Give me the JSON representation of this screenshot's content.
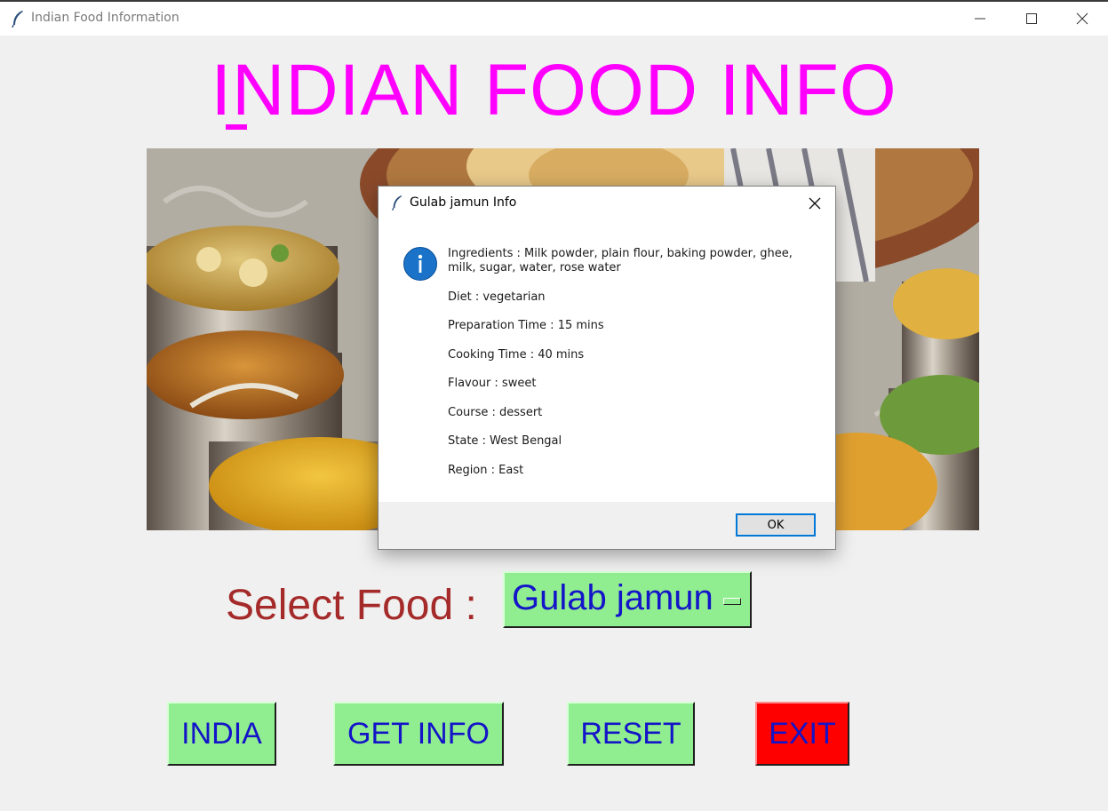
{
  "window": {
    "title": "Indian Food Information",
    "icon": "feather-icon"
  },
  "main": {
    "heading": "INDIAN FOOD INFO",
    "select_label": "Select Food :",
    "selected_food": "Gulab jamun",
    "buttons": {
      "india": "INDIA",
      "get_info": "GET INFO",
      "reset": "RESET",
      "exit": "EXIT"
    }
  },
  "dialog": {
    "title": "Gulab jamun Info",
    "icon": "info-icon",
    "lines": [
      "Ingredients  :  Milk powder, plain flour, baking powder, ghee, milk, sugar, water, rose water",
      "Diet  :  vegetarian",
      "Preparation Time  :  15 mins",
      "Cooking Time  :  40 mins",
      "Flavour  :  sweet",
      "Course  :  dessert",
      "State  :  West Bengal",
      "Region  :  East"
    ],
    "ok_label": "OK"
  },
  "colors": {
    "heading": "#ff00ff",
    "label": "#a52a2a",
    "button_bg": "#90ee90",
    "button_text": "#1414c8",
    "exit_bg": "#ff0000"
  }
}
